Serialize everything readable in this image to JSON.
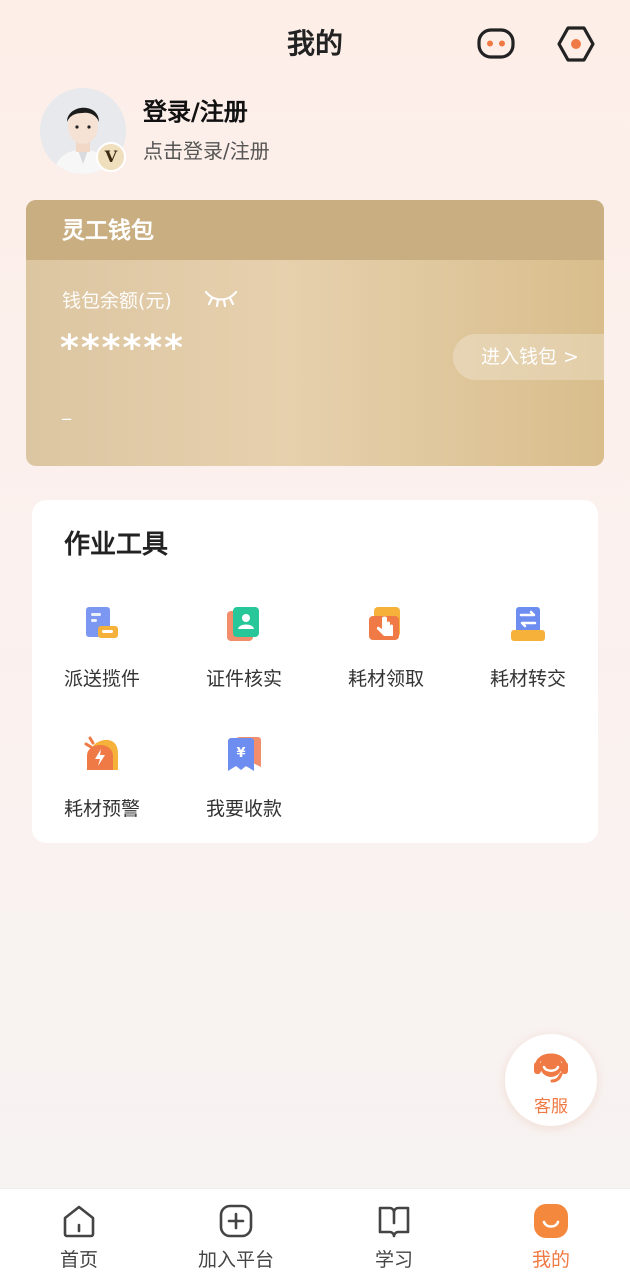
{
  "header": {
    "title": "我的",
    "message_icon": "message-icon",
    "settings_icon": "settings-icon"
  },
  "profile": {
    "title": "登录/注册",
    "subtitle": "点击登录/注册",
    "badge": "V"
  },
  "wallet": {
    "title": "灵工钱包",
    "balance_label": "钱包余额(元)",
    "balance": "******",
    "secondary": "_",
    "enter_label": "进入钱包 >",
    "eye_icon": "eye-closed-icon"
  },
  "tools": {
    "title": "作业工具",
    "items": [
      {
        "label": "派送揽件",
        "icon": "delivery-icon"
      },
      {
        "label": "证件核实",
        "icon": "id-verify-icon"
      },
      {
        "label": "耗材领取",
        "icon": "supply-receive-icon"
      },
      {
        "label": "耗材转交",
        "icon": "supply-transfer-icon"
      },
      {
        "label": "耗材预警",
        "icon": "supply-alert-icon"
      },
      {
        "label": "我要收款",
        "icon": "payment-icon"
      }
    ]
  },
  "service": {
    "label": "客服",
    "icon": "customer-service-icon"
  },
  "tabbar": {
    "items": [
      {
        "label": "首页",
        "icon": "home-icon"
      },
      {
        "label": "加入平台",
        "icon": "add-platform-icon"
      },
      {
        "label": "学习",
        "icon": "book-icon"
      },
      {
        "label": "我的",
        "icon": "profile-icon"
      }
    ],
    "active_index": 3
  },
  "colors": {
    "accent": "#f07a45",
    "wallet_gold": "#d9be8c",
    "wallet_head": "#c9ae82"
  }
}
